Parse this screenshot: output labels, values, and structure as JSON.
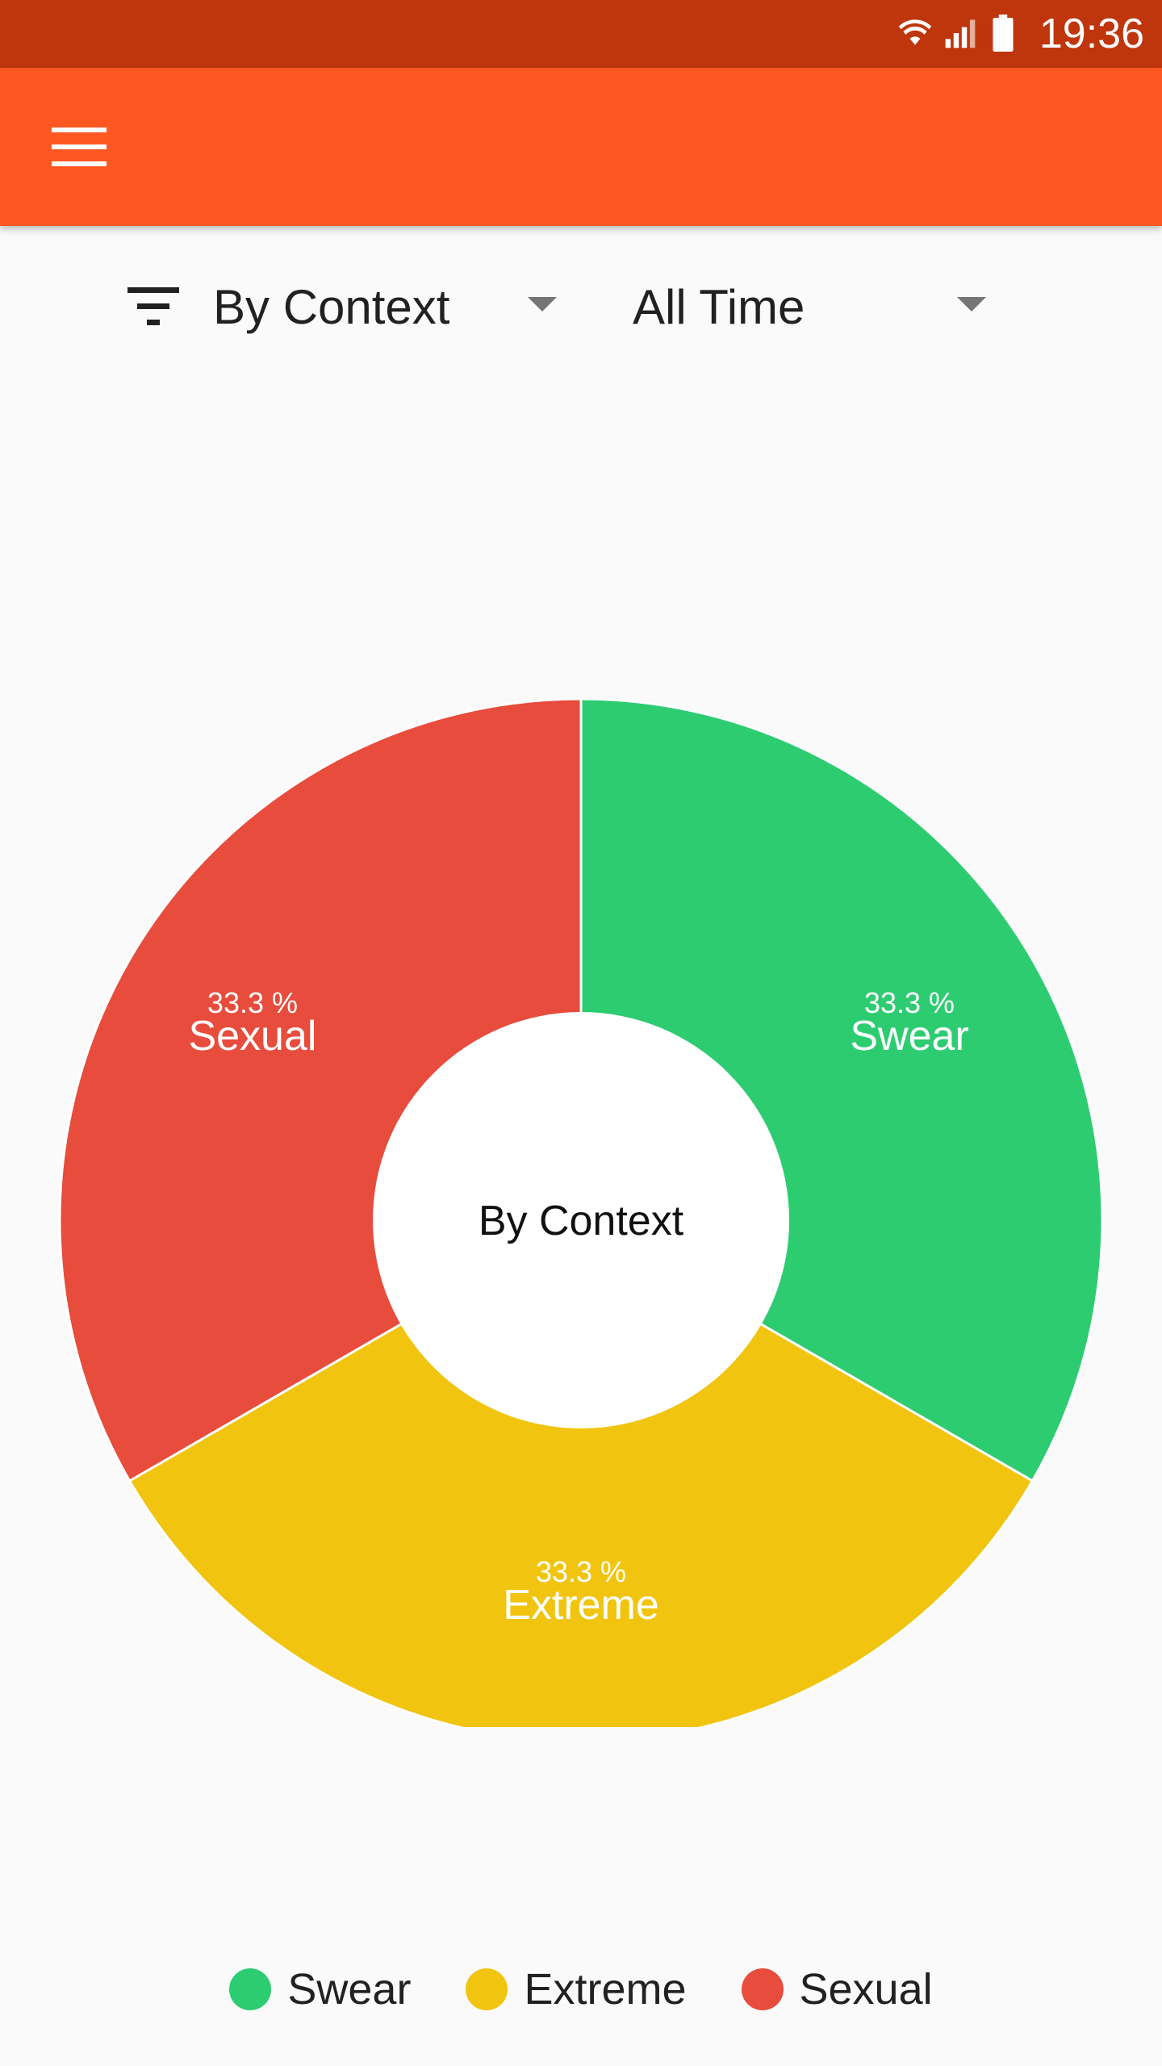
{
  "status_bar": {
    "time": "19:36",
    "icons": [
      "wifi-icon",
      "signal-icon",
      "battery-icon"
    ],
    "color": "#bf360c"
  },
  "app_bar": {
    "menu_icon": "menu-icon",
    "color": "#ff5722"
  },
  "filters": {
    "filter_icon": "filter-icon",
    "context": {
      "selected": "By Context"
    },
    "time_range": {
      "selected": "All Time"
    }
  },
  "chart_data": {
    "type": "pie",
    "center_label": "By Context",
    "categories": [
      "Swear",
      "Extreme",
      "Sexual"
    ],
    "values": [
      33.3,
      33.3,
      33.3
    ],
    "percent_labels": [
      "33.3 %",
      "33.3 %",
      "33.3 %"
    ],
    "colors": [
      "#2ecc71",
      "#f1c40f",
      "#e74c3c"
    ],
    "donut": true,
    "legend_position": "bottom"
  }
}
